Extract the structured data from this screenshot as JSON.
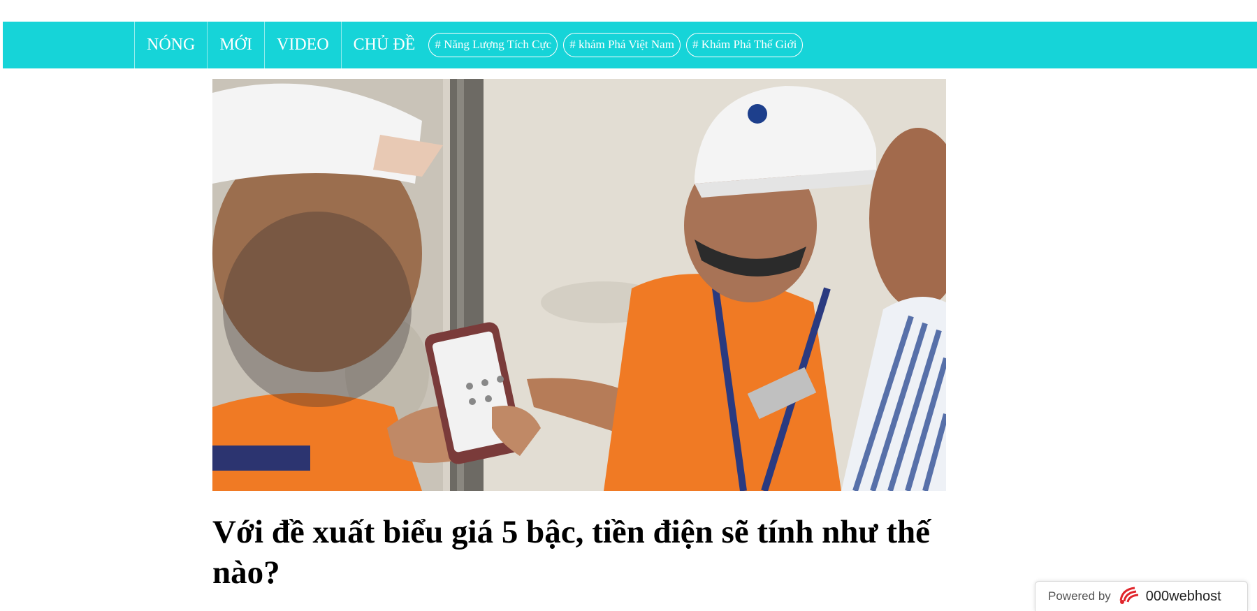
{
  "nav": {
    "items": [
      {
        "label": "NÓNG"
      },
      {
        "label": "MỚI"
      },
      {
        "label": "VIDEO"
      },
      {
        "label": "CHỦ ĐỀ"
      }
    ],
    "tags": [
      {
        "label": "# Năng Lượng Tích Cực"
      },
      {
        "label": "# khám Phá Việt Nam"
      },
      {
        "label": "# Khám Phá Thế Giới"
      }
    ]
  },
  "article": {
    "title": "Với đề xuất biểu giá 5 bậc, tiền điện sẽ tính như thế nào?"
  },
  "hosting_badge": {
    "powered_by": "Powered by",
    "brand": "000webhost"
  },
  "colors": {
    "navbar": "#16d4d8",
    "worker_uniform": "#f07a24",
    "helmet": "#f4f4f4"
  },
  "icons": {
    "badge_logo": "000webhost-logo-icon"
  }
}
